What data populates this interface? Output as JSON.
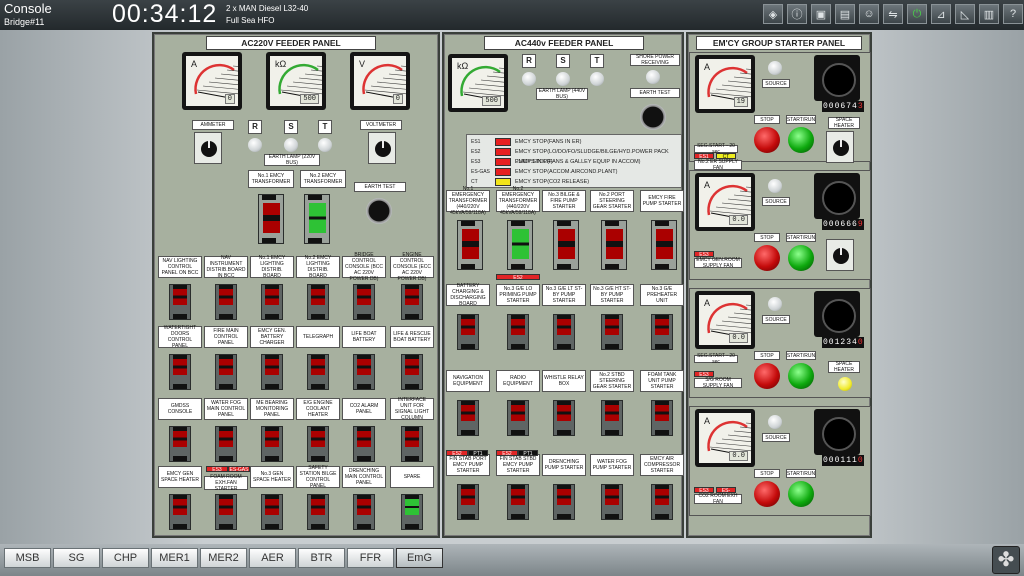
{
  "topbar": {
    "title": "Console",
    "location": "Bridge#11",
    "clock": "00:34:12",
    "engine_line1": "2 x MAN Diesel L32-40",
    "engine_line2": "Full Sea HFO",
    "icons": [
      "alarm-icon",
      "info-icon",
      "save-icon",
      "lock-icon",
      "user-icon",
      "link-icon",
      "exit-icon",
      "chart-icon",
      "graph-icon",
      "info2-icon",
      "help-icon",
      "refresh-icon",
      "print-icon"
    ]
  },
  "p220": {
    "title": "AC220V FEEDER PANEL",
    "meters": [
      {
        "sym": "A",
        "val": "0"
      },
      {
        "sym": "kΩ",
        "val": "500"
      },
      {
        "sym": "V",
        "val": "0"
      }
    ],
    "ammeter": "AMMETER",
    "voltmeter": "VOLTMETER",
    "r": "R",
    "s": "S",
    "t": "T",
    "earth_lamp": "EARTH LAMP (220V BUS)",
    "earth_test": "EARTH TEST",
    "tr1": "No.1 EMCY TRANSFORMER",
    "tr2": "No.2 EMCY TRANSFORMER",
    "rows": [
      [
        "NAV LIGHTING CONTROL PANEL ON BCC",
        "NAV INSTRUMENT DISTRIB.BOARD IN BCC",
        "No.1 EMCY LIGHTING DISTRIB. BOARD",
        "No.2 EMCY LIGHTING DISTRIB. BOARD",
        "BRIDGE CONTROL CONSOLE (BCC AC 220V POWER DB)",
        "ENGINE CONTROL CONSOLE (ECC AC 220V POWER DB)"
      ],
      [
        "WATERTIGHT DOORS CONTROL PANEL",
        "FIRE MAIN CONTROL PANEL",
        "EMCY GEN. BATTERY CHARGER",
        "TELEGRAPH",
        "LIFE BOAT BATTERY",
        "LIFE & RESCUE BOAT BATTERY"
      ],
      [
        "GMDSS CONSOLE",
        "WATER FOG MAIN CONTROL PANEL",
        "ME BEARING MONITORING PANEL",
        "E/G ENGINE COOLANT HEATER",
        "CO2 ALARM PANEL",
        "INTERFACE UNIT FOR SIGNAL LIGHT COLUMN"
      ],
      [
        "EMCY GEN SPACE HEATER",
        "FOAM ROOM EXH.FAN STARTER",
        "No.3 GEN SPACE HEATER",
        "SAFETY STATION BILGE CONTROL PANEL",
        "DRENCHING MAIN CONTROL PANEL",
        "SPARE"
      ]
    ],
    "ind_es3": "ES3",
    "ind_esgas": "ES-GAS"
  },
  "p440": {
    "title": "AC440v FEEDER PANEL",
    "meter": {
      "sym": "kΩ",
      "val": "500"
    },
    "r": "R",
    "s": "S",
    "t": "T",
    "earth_lamp": "EARTH LAMP (440V BUS)",
    "shore": "SHORE POWER RECEIVING",
    "earth_test": "EARTH TEST",
    "esd": [
      {
        "code": "ES1",
        "text": "EMCY STOP(FANS IN ER)"
      },
      {
        "code": "ES2",
        "text": "EMCY STOP(LO/DO/FO/SLUDGE/BILGE/HYD.POWER PACK PUMPS IN ER)"
      },
      {
        "code": "ES3",
        "text": "EMCY STOP(FANS & GALLEY EQUIP IN ACCOM)"
      },
      {
        "code": "ES-GAS",
        "text": "EMCY STOP(ACCOM.AIRCOND.PLANT)"
      },
      {
        "code": "CT",
        "text": "EMCY STOP(CO2 RELEASE)"
      }
    ],
    "rows": [
      [
        "No.1 EMERGENCY TRANSFORMER (440/220V 45kVA/59/118A)",
        "No.2 EMERGENCY TRANSFORMER (440/220V 45kVA/59/118A)",
        "No.3 BILGE & FIRE PUMP STARTER",
        "No.2 PORT STEERING GEAR STARTER",
        "EMCY FIRE PUMP STARTER"
      ],
      [
        "BATTERY CHARGING & DISCHARGING BOARD",
        "No.3 G/E LO PRIMING PUMP STARTER",
        "No.3 G/E LT ST-BY PUMP STARTER",
        "No.3 G/E HT ST-BY PUMP STARTER",
        "No.3 G/E PREHEATER UNIT"
      ],
      [
        "NAVIGATION EQUIPMENT",
        "RADIO EQUIPMENT",
        "WHISTLE RELAY BOX",
        "No.2 STBD STEERING GEAR STARTER",
        "FOAM TANK UNIT PUMP STARTER"
      ],
      [
        "FIN STAB PORT EMCY PUMP STARTER",
        "FIN STAB STBD EMCY PUMP STARTER",
        "DRENCHING PUMP STARTER",
        "WATER FOG PUMP STARTER",
        "EMCY AIR COMPRESSOR STARTER"
      ]
    ],
    "ind_es2": "ES2",
    "ind_pt1": "PT1"
  },
  "pemg": {
    "title": "EM'CY GROUP STARTER PANEL",
    "source": "SOURCE",
    "stop": "STOP",
    "start": "START/RUN",
    "seg_start": "SEG.START - 20 sec",
    "space_heater": "SPACE HEATER",
    "units": [
      {
        "val": "19",
        "counter": "000674",
        "counter_last": "3",
        "label": "No.2 ER SUPPLY FAN",
        "tags": [
          "ES1",
          "CT"
        ]
      },
      {
        "val": "0.0",
        "counter": "000666",
        "counter_last": "9",
        "label": "EMCY GEN.ROOM SUPPLY FAN",
        "tags": [
          "ES3"
        ]
      },
      {
        "val": "0.0",
        "counter": "001234",
        "counter_last": "0",
        "label": "S/G ROOM SUPPLY FAN",
        "tags": [
          "ES3"
        ]
      },
      {
        "val": "0.0",
        "counter": "000111",
        "counter_last": "0",
        "label": "CO2 ROOM EXH FAN",
        "tags": [
          "ES3",
          "ES-GAS"
        ]
      }
    ]
  },
  "tabs": [
    "MSB",
    "SG",
    "CHP",
    "MER1",
    "MER2",
    "AER",
    "BTR",
    "FFR",
    "EmG"
  ],
  "active_tab": "EmG"
}
